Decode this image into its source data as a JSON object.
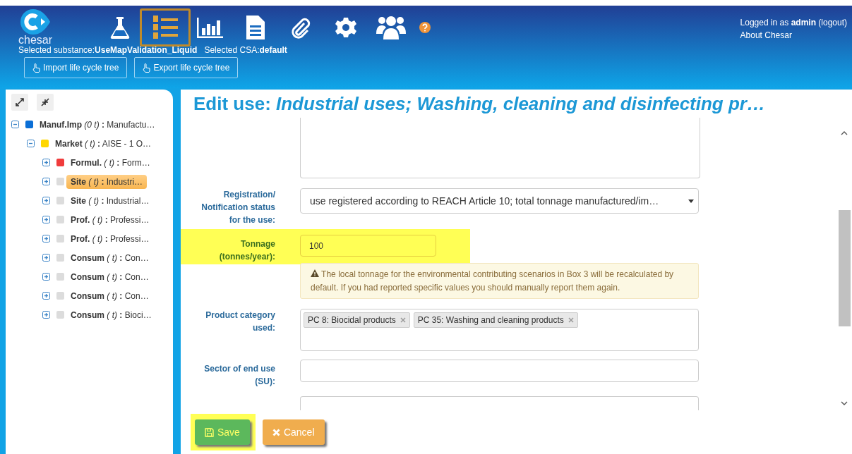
{
  "header": {
    "logo_text": "chesar",
    "nav": [
      {
        "kind": "flask",
        "selected": false
      },
      {
        "kind": "list",
        "selected": true
      },
      {
        "kind": "chart",
        "selected": false
      },
      {
        "kind": "document",
        "selected": false
      },
      {
        "kind": "paperclip",
        "selected": false
      },
      {
        "kind": "gear",
        "selected": false
      },
      {
        "kind": "users",
        "selected": false
      },
      {
        "kind": "help",
        "selected": false
      }
    ],
    "context": "Selected substance:**UseMapValidation_Liquid**   Selected CSA:**default**",
    "user": "Logged in as **admin** (logout)",
    "about": "About Chesar",
    "buttons": [
      "Import life cycle tree",
      "Export life cycle tree"
    ]
  },
  "tree": {
    "items": [
      {
        "label": "**Manuf.Imp** *(0 t)* **:** Manufactu…",
        "color": "#0b6fd6",
        "expanded": true,
        "selected": false,
        "children": [
          {
            "label": "**Market** *( t)* **:** AISE - 1 O…",
            "color": "#ffd700",
            "expanded": true,
            "selected": false,
            "children": [
              {
                "label": "**Formul.** *( t)* **:** Form…",
                "color": "#f03c3c",
                "expanded": false,
                "selected": false
              },
              {
                "label": "**Site** *( t)* **:** Industri…",
                "color": "#dcdcdc",
                "expanded": false,
                "selected": true
              },
              {
                "label": "**Site** *( t)* **:** Industrial…",
                "color": "#dcdcdc",
                "expanded": false,
                "selected": false
              },
              {
                "label": "**Prof.** *( t)* **:** Professi…",
                "color": "#dcdcdc",
                "expanded": false,
                "selected": false
              },
              {
                "label": "**Prof.** *( t)* **:** Professi…",
                "color": "#dcdcdc",
                "expanded": false,
                "selected": false
              },
              {
                "label": "**Consum** *( t)* **:** Con…",
                "color": "#dcdcdc",
                "expanded": false,
                "selected": false
              },
              {
                "label": "**Consum** *( t)* **:** Con…",
                "color": "#dcdcdc",
                "expanded": false,
                "selected": false
              },
              {
                "label": "**Consum** *( t)* **:** Con…",
                "color": "#dcdcdc",
                "expanded": false,
                "selected": false
              },
              {
                "label": "**Consum** *( t)* **:** Bioci…",
                "color": "#dcdcdc",
                "expanded": false,
                "selected": false
              }
            ]
          }
        ]
      }
    ]
  },
  "editor": {
    "title": "Edit use: *Industrial uses; Washing, cleaning and disinfecting pr…*",
    "fields": [
      {
        "kind": "textarea"
      },
      {
        "kind": "select",
        "label": "Registration/ Notification status for the use:",
        "value": "use registered according to REACH Article 10; total tonnage manufactured/im…"
      },
      {
        "kind": "input",
        "label": "Tonnage (tonnes/year):",
        "value": "100",
        "highlighted": true,
        "warning": "The local tonnage for the environmental contributing scenarios in Box 3 will be recalculated by default. If you had reported specific values you should manually report them again."
      },
      {
        "kind": "tags",
        "label": "Product category used:",
        "tags": [
          "PC 8: Biocidal products",
          "PC 35: Washing and cleaning products"
        ]
      },
      {
        "kind": "input",
        "label": "Sector of end use (SU):",
        "highlighted": false
      },
      {
        "kind": "partial"
      }
    ],
    "save": {
      "label": "Save",
      "highlighted": true
    },
    "cancel": {
      "label": "Cancel"
    }
  }
}
